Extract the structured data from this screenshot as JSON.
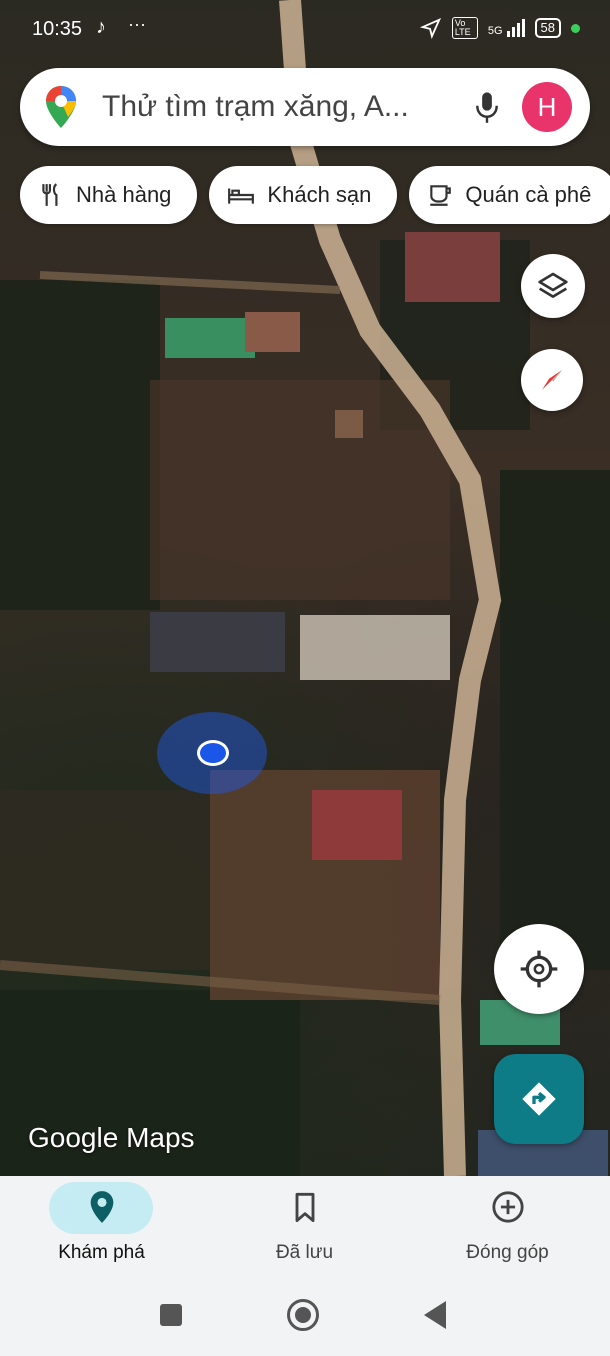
{
  "status_bar": {
    "time": "10:35",
    "network": "5G",
    "volte": "Vo LTE",
    "battery": "58"
  },
  "search": {
    "placeholder": "Thử tìm trạm xăng, A...",
    "avatar_letter": "H"
  },
  "chips": [
    {
      "label": "Nhà hàng",
      "icon": "fork-knife-icon"
    },
    {
      "label": "Khách sạn",
      "icon": "bed-icon"
    },
    {
      "label": "Quán cà phê",
      "icon": "coffee-icon"
    }
  ],
  "map": {
    "logo_text": "Google Maps"
  },
  "bottom_nav": {
    "items": [
      {
        "label": "Khám phá",
        "icon": "location-pin-icon",
        "active": true
      },
      {
        "label": "Đã lưu",
        "icon": "bookmark-icon",
        "active": false
      },
      {
        "label": "Đóng góp",
        "icon": "add-circle-icon",
        "active": false
      }
    ]
  },
  "colors": {
    "accent": "#0e7c86",
    "avatar": "#e8336b",
    "active_pill": "#c5ecf3",
    "location_dot": "#1a57e8"
  }
}
